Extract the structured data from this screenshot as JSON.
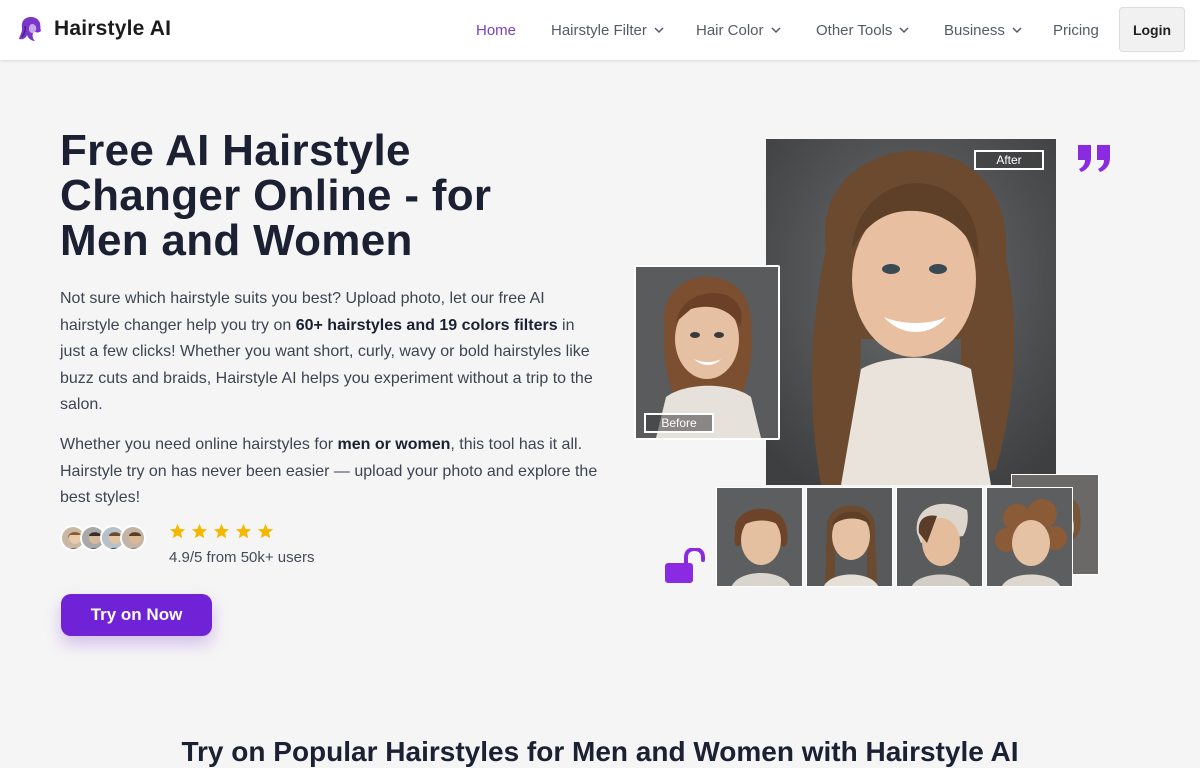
{
  "brand": {
    "name": "Hairstyle AI"
  },
  "nav": {
    "items": [
      {
        "label": "Home",
        "active": true,
        "dropdown": false
      },
      {
        "label": "Hairstyle Filter",
        "active": false,
        "dropdown": true
      },
      {
        "label": "Hair Color",
        "active": false,
        "dropdown": true
      },
      {
        "label": "Other Tools",
        "active": false,
        "dropdown": true
      },
      {
        "label": "Business",
        "active": false,
        "dropdown": true
      },
      {
        "label": "Pricing",
        "active": false,
        "dropdown": false
      }
    ],
    "login": "Login"
  },
  "hero": {
    "title": "Free AI Hairstyle Changer Online - for Men and Women",
    "p1_a": "Not sure which hairstyle suits you best? Upload photo, let our free AI hairstyle changer help you try on ",
    "p1_bold": "60+ hairstyles and 19 colors filters",
    "p1_b": " in just a few clicks! Whether you want short, curly, wavy or bold hairstyles like buzz cuts and braids, Hairstyle AI helps you experiment without a trip to the salon.",
    "p2_a": "Whether you need online hairstyles for ",
    "p2_bold": "men or women",
    "p2_b": ", this tool has it all. Hairstyle try on has never been easier — upload your photo and explore the best styles!",
    "rating_stars": 5,
    "rating_text": "4.9/5 from 50k+ users",
    "cta": "Try on Now"
  },
  "collage": {
    "after_label": "After",
    "before_label": "Before"
  },
  "section": {
    "title": "Try on Popular Hairstyles for Men and Women with Hairstyle AI"
  },
  "colors": {
    "accent": "#7022d6",
    "nav_active": "#7a3fc2",
    "star": "#f5b800",
    "icon_purple": "#8a2be2"
  },
  "icons": [
    "brand-logo-icon",
    "chevron-down-icon",
    "star-icon",
    "quote-icon",
    "unlock-icon"
  ]
}
